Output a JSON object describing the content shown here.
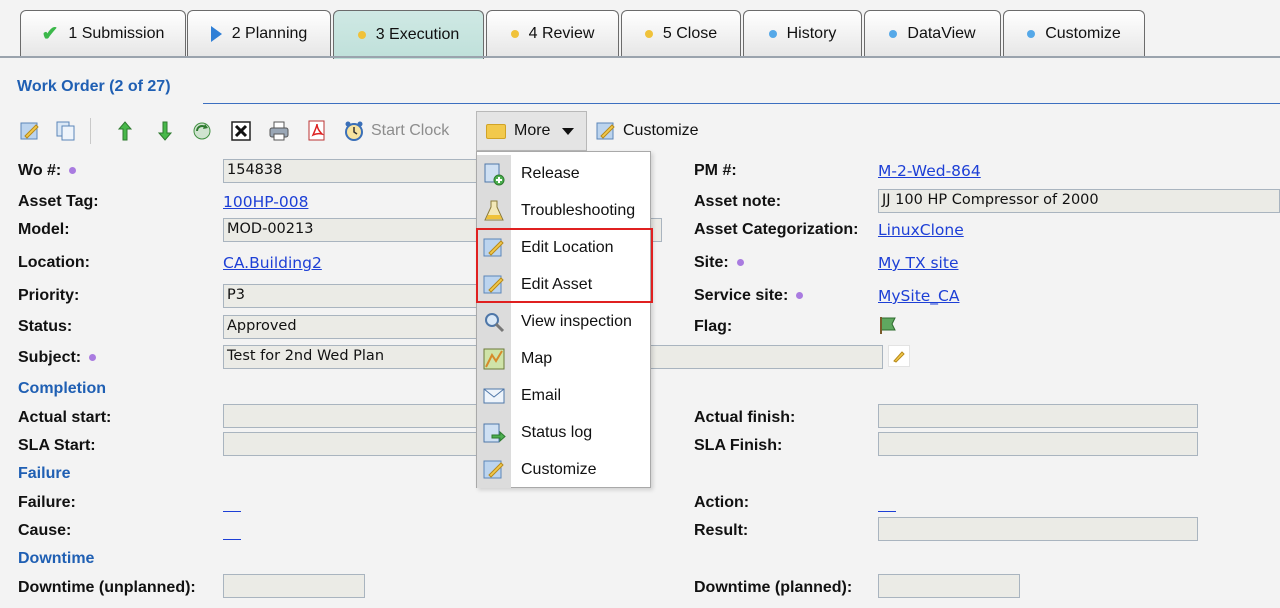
{
  "tabs": [
    {
      "label": "1 Submission",
      "icon": "check-icon"
    },
    {
      "label": "2 Planning",
      "icon": "triangle-icon"
    },
    {
      "label": "3 Execution",
      "icon": "yellow-dot-icon",
      "active": true
    },
    {
      "label": "4 Review",
      "icon": "yellow-dot-icon"
    },
    {
      "label": "5 Close",
      "icon": "yellow-dot-icon"
    },
    {
      "label": "History",
      "icon": "blue-dot-icon"
    },
    {
      "label": "DataView",
      "icon": "blue-dot-icon"
    },
    {
      "label": "Customize",
      "icon": "blue-dot-icon"
    }
  ],
  "form": {
    "title": "Work Order (2 of 27)"
  },
  "toolbar": {
    "start_clock": "Start Clock",
    "more": "More",
    "customize": "Customize"
  },
  "fields": {
    "wo_label": "Wo #:",
    "wo_value": "154838",
    "asset_tag_label": "Asset Tag:",
    "asset_tag_value": "100HP-008",
    "model_label": "Model:",
    "model_value": "MOD-00213",
    "location_label": "Location:",
    "location_value": "CA.Building2",
    "priority_label": "Priority:",
    "priority_value": "P3",
    "status_label": "Status:",
    "status_value": "Approved",
    "subject_label": "Subject:",
    "subject_value": "Test for 2nd Wed Plan",
    "pm_label": "PM #:",
    "pm_value": "M-2-Wed-864",
    "asset_note_label": "Asset note:",
    "asset_note_value": "JJ 100 HP Compressor of 2000",
    "asset_cat_label": "Asset Categorization:",
    "asset_cat_value": "LinuxClone",
    "site_label": "Site:",
    "site_value": "My TX site",
    "service_site_label": "Service site:",
    "service_site_value": "MySite_CA",
    "flag_label": "Flag:"
  },
  "sections": {
    "completion": "Completion",
    "failure": "Failure",
    "downtime": "Downtime"
  },
  "completion": {
    "actual_start_label": "Actual start:",
    "sla_start_label": "SLA Start:",
    "actual_finish_label": "Actual finish:",
    "sla_finish_label": "SLA Finish:"
  },
  "failure": {
    "failure_label": "Failure:",
    "cause_label": "Cause:",
    "action_label": "Action:",
    "result_label": "Result:"
  },
  "downtime": {
    "unplanned_label": "Downtime (unplanned):",
    "planned_label": "Downtime (planned):"
  },
  "menu": {
    "items": [
      {
        "label": "Release",
        "icon": "release-icon"
      },
      {
        "label": "Troubleshooting",
        "icon": "troubleshooting-icon"
      },
      {
        "label": "Edit Location",
        "icon": "edit-location-icon"
      },
      {
        "label": "Edit Asset",
        "icon": "edit-asset-icon"
      },
      {
        "label": "View inspection",
        "icon": "magnifier-icon"
      },
      {
        "label": "Map",
        "icon": "map-icon"
      },
      {
        "label": "Email",
        "icon": "email-icon"
      },
      {
        "label": "Status log",
        "icon": "status-log-icon"
      },
      {
        "label": "Customize",
        "icon": "customize-icon"
      }
    ]
  },
  "colors": {
    "section_blue": "#1f5fb3",
    "link_blue": "#1d3fd6",
    "active_tab": "#cfe9e4",
    "highlight_red": "#e02020"
  }
}
